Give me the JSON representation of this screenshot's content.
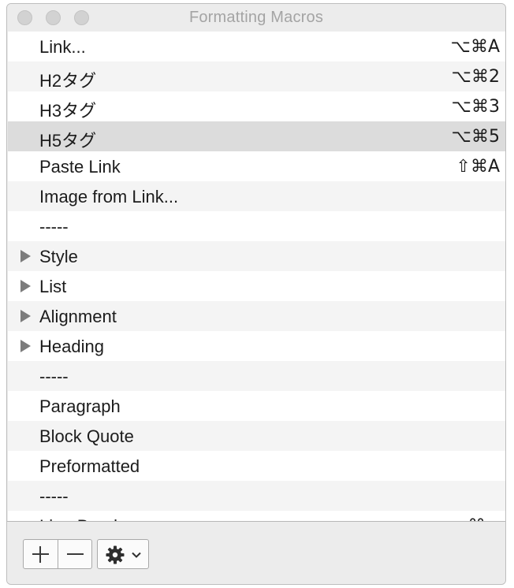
{
  "window": {
    "title": "Formatting Macros"
  },
  "macros": [
    {
      "label": "Link...",
      "shortcut": "⌥⌘A",
      "has_children": false,
      "selected": false
    },
    {
      "label": "H2タグ",
      "shortcut": "⌥⌘2",
      "has_children": false,
      "selected": false
    },
    {
      "label": "H3タグ",
      "shortcut": "⌥⌘3",
      "has_children": false,
      "selected": false
    },
    {
      "label": "H5タグ",
      "shortcut": "⌥⌘5",
      "has_children": false,
      "selected": true
    },
    {
      "label": "Paste Link",
      "shortcut": "⇧⌘A",
      "has_children": false,
      "selected": false
    },
    {
      "label": "Image from Link...",
      "shortcut": "",
      "has_children": false,
      "selected": false
    },
    {
      "label": "-----",
      "shortcut": "",
      "has_children": false,
      "selected": false
    },
    {
      "label": "Style",
      "shortcut": "",
      "has_children": true,
      "selected": false
    },
    {
      "label": "List",
      "shortcut": "",
      "has_children": true,
      "selected": false
    },
    {
      "label": "Alignment",
      "shortcut": "",
      "has_children": true,
      "selected": false
    },
    {
      "label": "Heading",
      "shortcut": "",
      "has_children": true,
      "selected": false
    },
    {
      "label": "-----",
      "shortcut": "",
      "has_children": false,
      "selected": false
    },
    {
      "label": "Paragraph",
      "shortcut": "",
      "has_children": false,
      "selected": false
    },
    {
      "label": "Block Quote",
      "shortcut": "",
      "has_children": false,
      "selected": false
    },
    {
      "label": "Preformatted",
      "shortcut": "",
      "has_children": false,
      "selected": false
    },
    {
      "label": "-----",
      "shortcut": "",
      "has_children": false,
      "selected": false
    },
    {
      "label": "Line Break",
      "shortcut": "⌘↩",
      "has_children": false,
      "selected": false
    }
  ],
  "toolbar": {
    "add_icon": "plus-icon",
    "remove_icon": "minus-icon",
    "action_icon": "gear-icon",
    "menu_icon": "chevron-down-icon"
  }
}
